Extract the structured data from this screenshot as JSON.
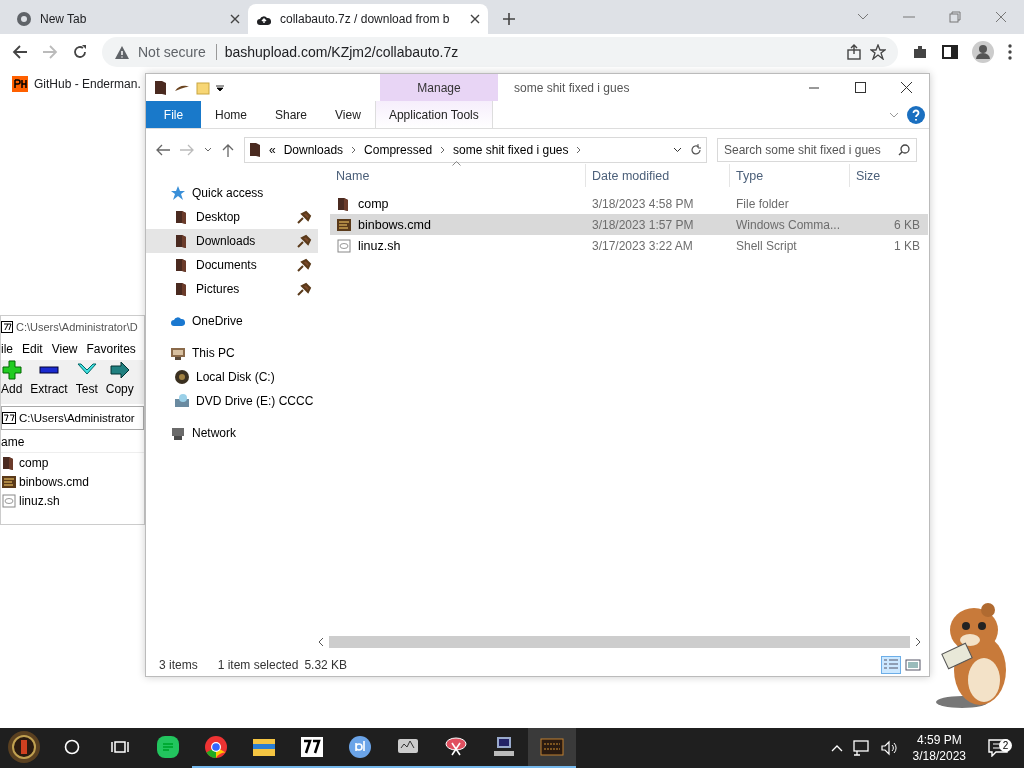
{
  "browser": {
    "tabs": [
      {
        "title": "New Tab",
        "selected": false
      },
      {
        "title": "collabauto.7z / download from b",
        "selected": true
      }
    ],
    "security": "Not secure",
    "url": "bashupload.com/KZjm2/collabauto.7z",
    "bookmarks": [
      {
        "label": "GitHub - Enderman."
      }
    ]
  },
  "archive_window": {
    "title": "C:\\Users\\Administrator\\D",
    "menu": [
      "ile",
      "Edit",
      "View",
      "Favorites"
    ],
    "toolbar": [
      {
        "label": "Add",
        "kind": "add"
      },
      {
        "label": "Extract",
        "kind": "extract"
      },
      {
        "label": "Test",
        "kind": "test"
      },
      {
        "label": "Copy",
        "kind": "copy"
      }
    ],
    "path": "C:\\Users\\Administrator",
    "column": "ame",
    "rows": [
      {
        "name": "comp",
        "kind": "folder"
      },
      {
        "name": "binbows.cmd",
        "kind": "script"
      },
      {
        "name": "linuz.sh",
        "kind": "file"
      }
    ]
  },
  "explorer": {
    "title": "some shit fixed i gues",
    "context_group": "Manage",
    "ribbon_tabs": [
      {
        "label": "File",
        "kind": "file-menu",
        "selected": false
      },
      {
        "label": "Home",
        "kind": "tab",
        "selected": false
      },
      {
        "label": "Share",
        "kind": "tab",
        "selected": false
      },
      {
        "label": "View",
        "kind": "tab",
        "selected": false
      },
      {
        "label": "Application Tools",
        "kind": "context",
        "selected": false
      }
    ],
    "breadcrumb": {
      "overflow": "«",
      "parts": [
        "Downloads",
        "Compressed",
        "some shit fixed i gues"
      ]
    },
    "search": {
      "placeholder": "Search some shit fixed i gues"
    },
    "nav": [
      {
        "label": "Quick access",
        "kind": "star",
        "selected": false,
        "children": [
          {
            "label": "Desktop",
            "kind": "folder",
            "pinned": true,
            "selected": false
          },
          {
            "label": "Downloads",
            "kind": "folder",
            "pinned": true,
            "selected": true
          },
          {
            "label": "Documents",
            "kind": "folder",
            "pinned": true,
            "selected": false
          },
          {
            "label": "Pictures",
            "kind": "folder",
            "pinned": true,
            "selected": false
          }
        ]
      },
      {
        "label": "OneDrive",
        "kind": "cloud",
        "selected": false
      },
      {
        "label": "This PC",
        "kind": "pc",
        "selected": false,
        "children": [
          {
            "label": "Local Disk (C:)",
            "kind": "disk",
            "pinned": false,
            "selected": false
          },
          {
            "label": "DVD Drive (E:) CCCC",
            "kind": "dvd",
            "pinned": false,
            "selected": false
          }
        ]
      },
      {
        "label": "Network",
        "kind": "network",
        "selected": false
      }
    ],
    "columns": [
      {
        "label": "Name",
        "sorted": true
      },
      {
        "label": "Date modified",
        "sorted": false
      },
      {
        "label": "Type",
        "sorted": false
      },
      {
        "label": "Size",
        "sorted": false
      }
    ],
    "rows": [
      {
        "name": "comp",
        "date": "3/18/2023 4:58 PM",
        "type": "File folder",
        "kind": "folder",
        "selected": false
      },
      {
        "name": "binbows.cmd",
        "date": "3/18/2023 1:57 PM",
        "type": "Windows Comma...",
        "size": "6 KB",
        "kind": "script",
        "selected": true
      },
      {
        "name": "linuz.sh",
        "date": "3/17/2023 3:22 AM",
        "type": "Shell Script",
        "size": "1 KB",
        "kind": "file",
        "selected": false
      }
    ],
    "status": {
      "count": "3 items",
      "selection": "1 item selected",
      "size": "5.32 KB"
    },
    "views": [
      {
        "kind": "details",
        "selected": true
      },
      {
        "kind": "thumbnails",
        "selected": false
      }
    ]
  },
  "taskbar": {
    "apps": [
      {
        "kind": "notes",
        "running": false,
        "selected": false
      },
      {
        "kind": "chrome",
        "running": true,
        "selected": false
      },
      {
        "kind": "explorer",
        "running": true,
        "selected": false
      },
      {
        "kind": "sevenzip",
        "running": true,
        "selected": false
      },
      {
        "kind": "qb",
        "running": true,
        "selected": false
      },
      {
        "kind": "monitor",
        "running": true,
        "selected": false
      },
      {
        "kind": "scissors",
        "running": true,
        "selected": false
      },
      {
        "kind": "computer",
        "running": true,
        "selected": false
      },
      {
        "kind": "clock",
        "running": true,
        "selected": true
      }
    ],
    "time": "4:59 PM",
    "date": "3/18/2023",
    "notifications": "2"
  }
}
